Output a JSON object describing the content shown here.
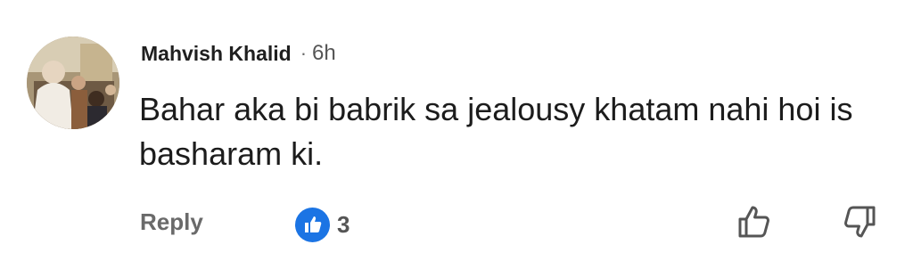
{
  "comment": {
    "author": "Mahvish Khalid",
    "separator": "·",
    "time": "6h",
    "text": "Bahar aka bi babrik sa jealousy khatam nahi hoi is basharam ki.",
    "reply_label": "Reply",
    "reaction": {
      "icon": "thumbs-up-icon",
      "count": "3",
      "color": "#1b74e4"
    },
    "upvote_icon": "thumbs-up-outline-icon",
    "downvote_icon": "thumbs-down-outline-icon"
  }
}
